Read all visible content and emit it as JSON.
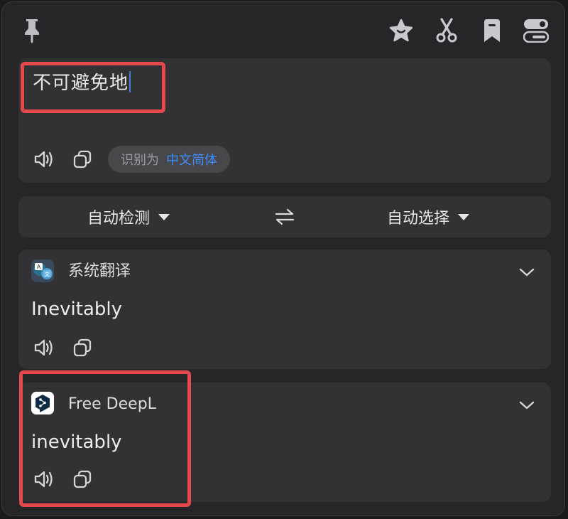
{
  "toolbar": {
    "pin_icon": "pin-icon",
    "favorite_icon": "star-icon",
    "screenshot_icon": "scissors-icon",
    "bookmark_icon": "bookmark-icon",
    "settings_icon": "toggle-icon"
  },
  "source": {
    "text": "不可避免地",
    "detected_prefix": "识别为",
    "detected_language": "中文简体"
  },
  "language_bar": {
    "from": "自动检测",
    "to": "自动选择"
  },
  "services": [
    {
      "name": "系统翻译",
      "result": "Inevitably"
    },
    {
      "name": "Free DeepL",
      "result": "inevitably"
    }
  ],
  "colors": {
    "accent": "#3d8bfd",
    "highlight": "#e5484d",
    "card": "#323234",
    "background": "#262628"
  }
}
